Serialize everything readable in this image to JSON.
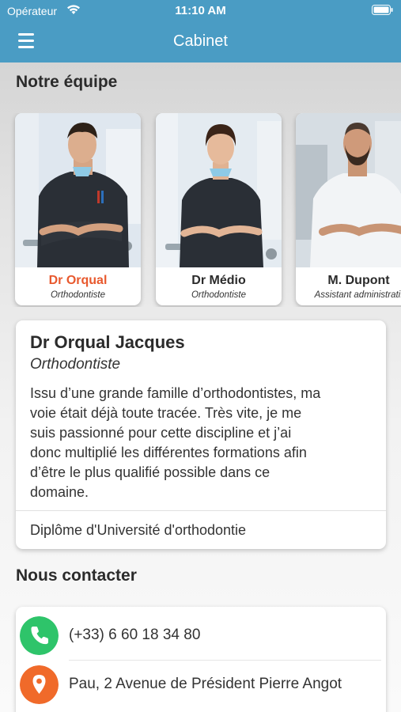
{
  "status_bar": {
    "carrier": "Opérateur",
    "time": "11:10 AM"
  },
  "nav": {
    "title": "Cabinet"
  },
  "team_section": {
    "title": "Notre équipe"
  },
  "team": [
    {
      "name": "Dr Orqual",
      "role": "Orthodontiste",
      "selected": true
    },
    {
      "name": "Dr Médio",
      "role": "Orthodontiste",
      "selected": false
    },
    {
      "name": "M. Dupont",
      "role": "Assistant administratif",
      "selected": false
    }
  ],
  "detail": {
    "name": "Dr Orqual Jacques",
    "role": "Orthodontiste",
    "bio_lines": [
      "Issu d’une grande famille d’orthodontistes, ma",
      "voie était déjà toute tracée. Très vite, je me",
      "suis passionné pour cette discipline et j’ai",
      "donc multiplié les différentes formations afin",
      "d’être le plus qualifié possible dans ce",
      "domaine."
    ],
    "diploma": "Diplôme d'Université d'orthodontie"
  },
  "contact_section": {
    "title": "Nous contacter"
  },
  "contact": {
    "phone": "(+33) 6 60 18 34 80",
    "address": "Pau, 2 Avenue de Président Pierre Angot"
  },
  "colors": {
    "header": "#4a9cc4",
    "accent": "#e8592e",
    "phone_icon": "#2ec46a",
    "location_icon": "#f06a2a"
  },
  "icons": {
    "menu": "hamburger-menu-icon",
    "phone": "phone-icon",
    "location": "location-pin-icon"
  }
}
